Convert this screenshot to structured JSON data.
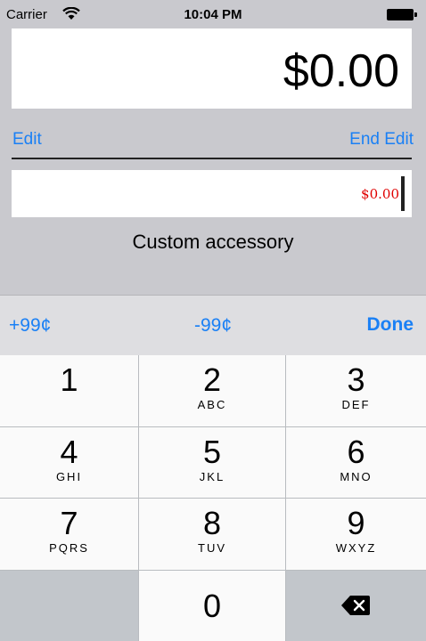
{
  "status_bar": {
    "carrier": "Carrier",
    "time": "10:04 PM",
    "wifi_icon": "wifi-icon",
    "battery_icon": "battery-icon"
  },
  "amount_display": {
    "value": "$0.00"
  },
  "edit_row": {
    "edit": "Edit",
    "end_edit": "End Edit"
  },
  "amount_field": {
    "value": "$0.00"
  },
  "custom_accessory_label": "Custom accessory",
  "accessory_bar": {
    "plus": "+99¢",
    "minus": "-99¢",
    "done": "Done"
  },
  "keypad": {
    "keys": [
      {
        "digit": "1",
        "letters": ""
      },
      {
        "digit": "2",
        "letters": "ABC"
      },
      {
        "digit": "3",
        "letters": "DEF"
      },
      {
        "digit": "4",
        "letters": "GHI"
      },
      {
        "digit": "5",
        "letters": "JKL"
      },
      {
        "digit": "6",
        "letters": "MNO"
      },
      {
        "digit": "7",
        "letters": "PQRS"
      },
      {
        "digit": "8",
        "letters": "TUV"
      },
      {
        "digit": "9",
        "letters": "WXYZ"
      },
      {
        "digit": "0",
        "letters": ""
      }
    ],
    "backspace_icon": "backspace-icon"
  },
  "colors": {
    "accent": "#1a80f5",
    "field_text": "#e00000",
    "background": "#c9c9ce",
    "key": "#fafafa",
    "keypad_bg": "#b9bcc0"
  }
}
